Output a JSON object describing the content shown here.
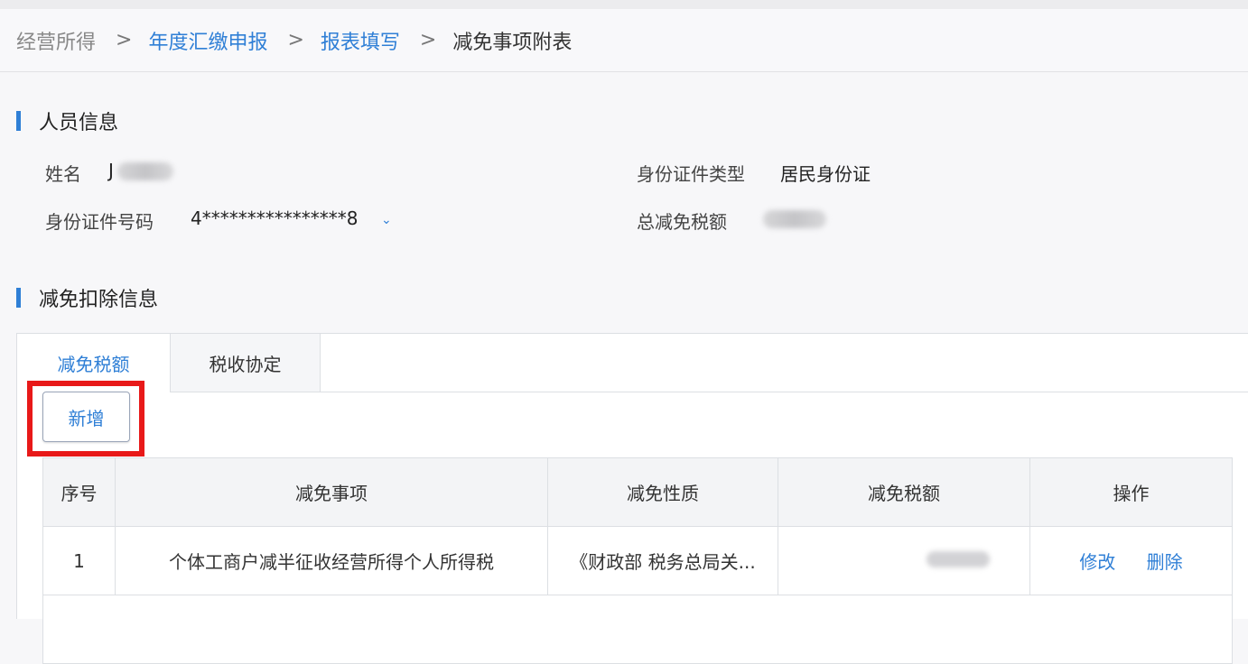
{
  "breadcrumb": {
    "items": [
      "经营所得",
      "年度汇缴申报",
      "报表填写",
      "减免事项附表"
    ],
    "separator": ">"
  },
  "personal": {
    "title": "人员信息",
    "name_label": "姓名",
    "name_value_first_char": "J",
    "id_type_label": "身份证件类型",
    "id_type_value": "居民身份证",
    "id_number_label": "身份证件号码",
    "id_number_value": "4****************8",
    "total_relief_label": "总减免税额"
  },
  "relief": {
    "title": "减免扣除信息",
    "tabs": [
      "减免税额",
      "税收协定"
    ],
    "add_button": "新增",
    "table": {
      "headers": [
        "序号",
        "减免事项",
        "减免性质",
        "减免税额",
        "操作"
      ],
      "rows": [
        {
          "index": "1",
          "item": "个体工商户减半征收经营所得个人所得税",
          "nature": "《财政部 税务总局关...",
          "actions": [
            "修改",
            "删除"
          ]
        }
      ]
    }
  },
  "colors": {
    "accent": "#2f7fd6",
    "highlight": "#e81919"
  }
}
